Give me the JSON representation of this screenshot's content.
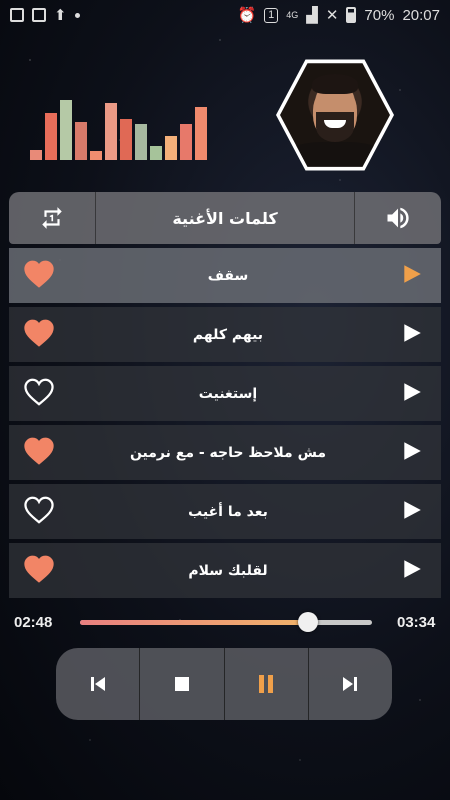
{
  "status_bar": {
    "network": "4G",
    "sim_badge": "1",
    "battery": "70%",
    "time": "20:07"
  },
  "colors": {
    "accent_orange": "#f0a04a",
    "heart_fill": "#f28566",
    "progress_start": "#e98080",
    "progress_end": "#f1b36a"
  },
  "equalizer": {
    "bars": [
      {
        "level": 0.16,
        "color": "#e88a78"
      },
      {
        "level": 0.76,
        "color": "#e86d5a"
      },
      {
        "level": 0.96,
        "color": "#b5c9a6"
      },
      {
        "level": 0.62,
        "color": "#d77a6a"
      },
      {
        "level": 0.14,
        "color": "#f08d6f"
      },
      {
        "level": 0.92,
        "color": "#eb9a86"
      },
      {
        "level": 0.66,
        "color": "#e06955"
      },
      {
        "level": 0.58,
        "color": "#a7b9a0"
      },
      {
        "level": 0.22,
        "color": "#a6c39a"
      },
      {
        "level": 0.38,
        "color": "#f3b07a"
      },
      {
        "level": 0.58,
        "color": "#e7796a"
      },
      {
        "level": 0.86,
        "color": "#f08a6d"
      }
    ]
  },
  "header": {
    "repeat_icon": "repeat-one-icon",
    "title": "كلمات الأغنية",
    "volume_icon": "volume-icon"
  },
  "songs": [
    {
      "title": "سقف",
      "favorite": true,
      "active": true
    },
    {
      "title": "بيهم كلهم",
      "favorite": true,
      "active": false
    },
    {
      "title": "إستغنيت",
      "favorite": false,
      "active": false
    },
    {
      "title": "مش ملاحظ حاجه - مع نرمين",
      "favorite": true,
      "active": false
    },
    {
      "title": "بعد ما أغيب",
      "favorite": false,
      "active": false
    },
    {
      "title": "لقلبك سلام",
      "favorite": true,
      "active": false
    }
  ],
  "player": {
    "current_time": "02:48",
    "total_time": "03:34",
    "progress": 0.78,
    "controls": [
      "previous-icon",
      "stop-icon",
      "pause-icon",
      "next-icon"
    ]
  }
}
